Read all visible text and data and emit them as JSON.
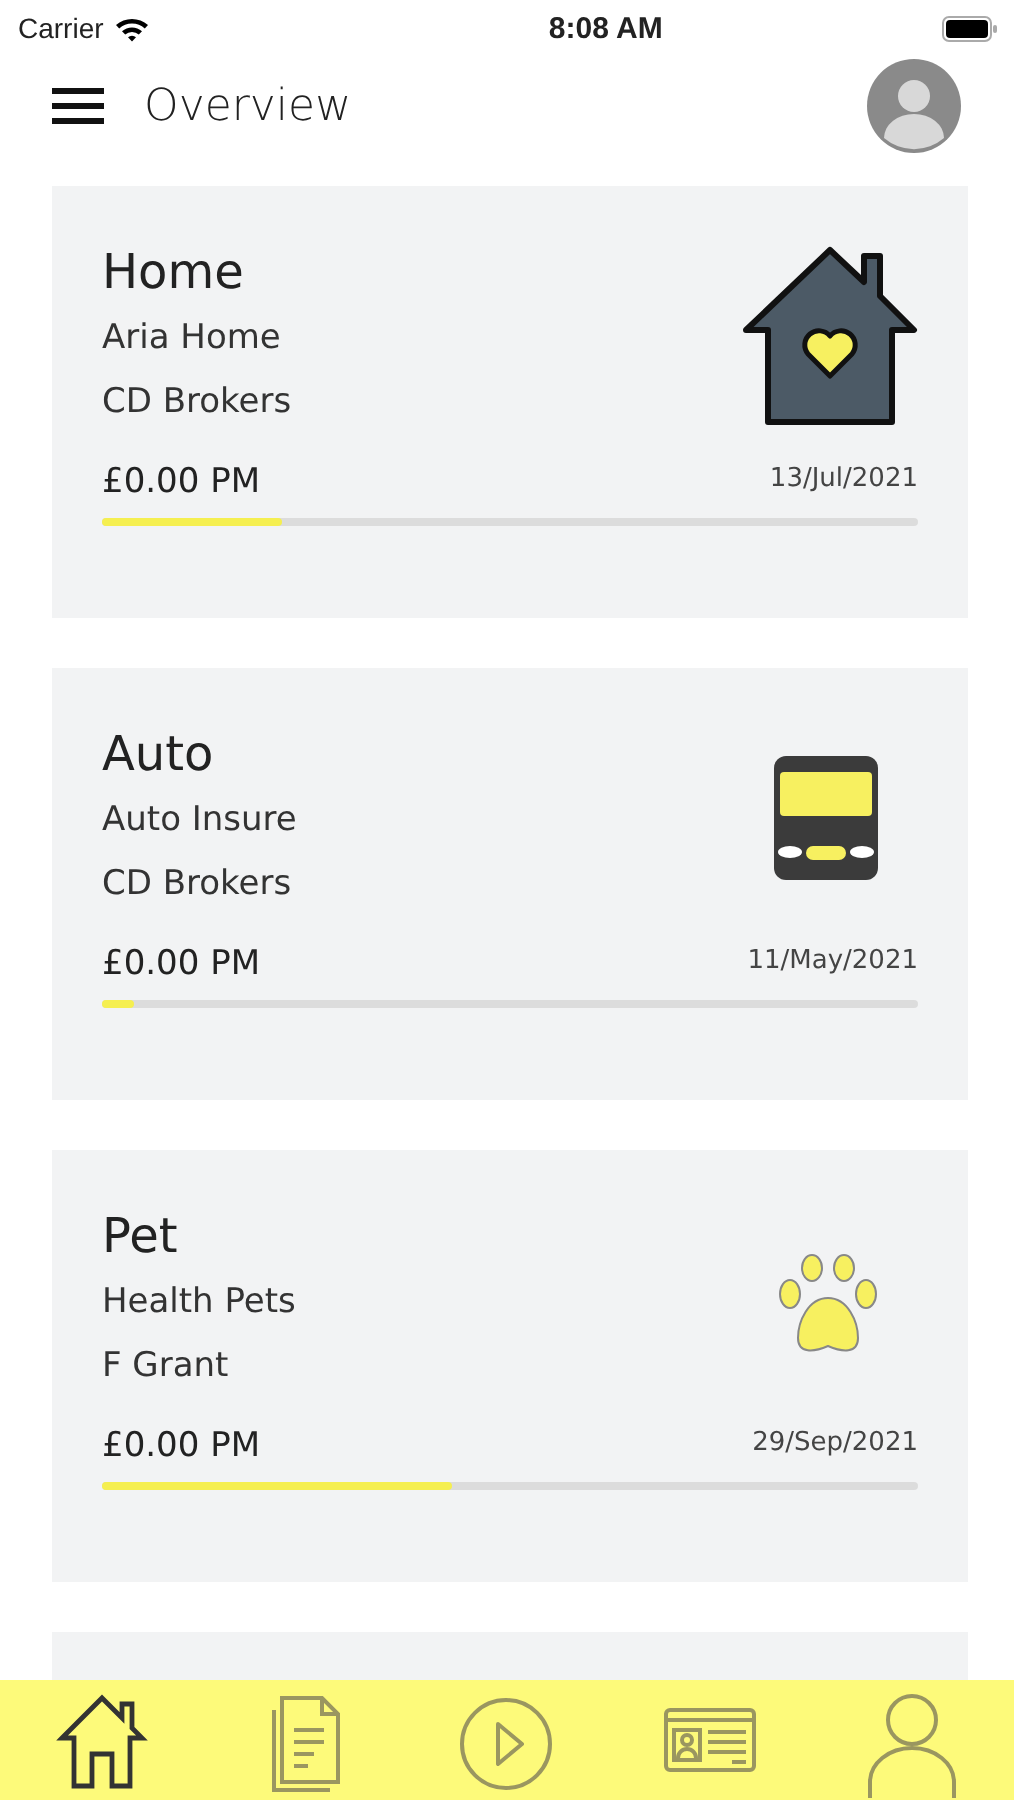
{
  "status_bar": {
    "carrier": "Carrier",
    "time": "8:08 AM"
  },
  "header": {
    "title": "Overview"
  },
  "cards": [
    {
      "kind": "home",
      "title": "Home",
      "name": "Aria Home",
      "broker": "CD Brokers",
      "amount": "£0.00 PM",
      "date": "13/Jul/2021",
      "level": 0.22
    },
    {
      "kind": "auto",
      "title": "Auto",
      "name": "Auto Insure",
      "broker": "CD Brokers",
      "amount": "£0.00 PM",
      "date": "11/May/2021",
      "level": 0.04
    },
    {
      "kind": "pet",
      "title": "Pet",
      "name": "Health Pets",
      "broker": "F Grant",
      "amount": "£0.00 PM",
      "date": "29/Sep/2021",
      "level": 0.43
    }
  ],
  "tab_bar": [
    {
      "kind": "home",
      "selected": true
    },
    {
      "kind": "document",
      "selected": false
    },
    {
      "kind": "play",
      "selected": false
    },
    {
      "kind": "id-card",
      "selected": false
    },
    {
      "kind": "profile",
      "selected": false
    }
  ]
}
